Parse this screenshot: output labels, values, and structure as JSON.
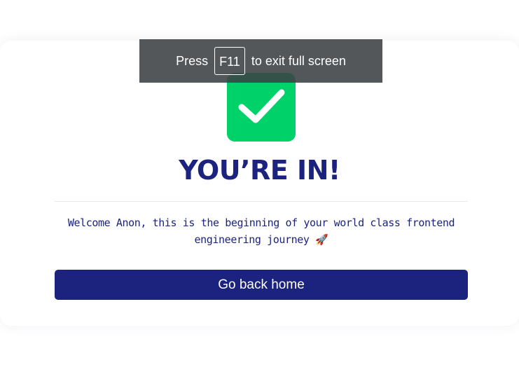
{
  "colors": {
    "accent_green": "#00d26a",
    "navy": "#1b237e",
    "toast_bg": "#3c4043"
  },
  "success_icon": "checkmark-icon",
  "heading": "YOU’RE IN!",
  "welcome_message": "Welcome Anon, this is the beginning of your world class frontend engineering journey",
  "welcome_emoji": "🚀",
  "welcome_emoji_icon": "rocket-icon",
  "button_label": "Go back home",
  "fullscreen_notice": {
    "before": "Press",
    "key": "F11",
    "after": "to exit full screen"
  }
}
